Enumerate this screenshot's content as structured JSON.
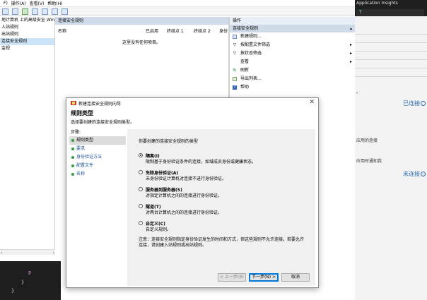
{
  "menubar": {
    "items": [
      "F)",
      "操作(A)",
      "查看(V)",
      "帮助(H)"
    ]
  },
  "tree": {
    "items": [
      "地计算机 上的高级安全 Win",
      "入站规则",
      "出站规则",
      "连接安全规则",
      "监视"
    ],
    "selected_index": 3
  },
  "middle": {
    "title": "连接安全规则",
    "columns": [
      "名称",
      "已启用",
      "终结点 1",
      "终结点 2",
      "身份"
    ],
    "empty_text": "这里没有任何项目。"
  },
  "actions": {
    "header": "操作",
    "section": "连接安全规则",
    "items": [
      {
        "label": "新建规则...",
        "icon": "new-rule-icon"
      },
      {
        "label": "按配置文件筛选",
        "icon": "filter-icon",
        "submenu": true
      },
      {
        "label": "按状态筛选",
        "icon": "filter-icon",
        "submenu": true
      },
      {
        "label": "查看",
        "icon": "",
        "submenu": true
      },
      {
        "label": "刷新",
        "icon": "refresh-icon"
      },
      {
        "label": "导出列表...",
        "icon": "export-icon"
      },
      {
        "label": "帮助",
        "icon": "help-icon"
      }
    ]
  },
  "right_strip": {
    "app_label": "Application Insights",
    "fragments": [
      "。",
      "应用的连接",
      "应用时通知我"
    ],
    "status_connected": "已连接",
    "status_disconnected": "未连接"
  },
  "dialog": {
    "title": "新建连接安全规则向导",
    "heading": "规则类型",
    "subheading": "选择要创建的连接安全规则类型。",
    "steps_label": "步骤:",
    "steps": [
      "规则类型",
      "要求",
      "身份验证方法",
      "配置文件",
      "名称"
    ],
    "current_step": 0,
    "question": "你要创建的连接安全规则的类型",
    "options": [
      {
        "label": "隔离(I)",
        "desc": "限制基于身份验证条件的连接，如域成员身份或健康状态。",
        "selected": true
      },
      {
        "label": "免除身份验证(A)",
        "desc": "未身份验证计算机对连接不进行身份验证。",
        "selected": false
      },
      {
        "label": "服务器到服务器(S)",
        "desc": "对指定计算机之间的连接进行身份验证。",
        "selected": false
      },
      {
        "label": "隧道(T)",
        "desc": "对两台计算机之间的连接进行身份验证。",
        "selected": false
      },
      {
        "label": "自定义(C)",
        "desc": "自定义规则。",
        "selected": false
      }
    ],
    "note": "注意：连接安全规则指定身份验证发生的时间和方式，但这些规则不允许连接。若要允许连接，请创建入站规则或出站规则。",
    "buttons": {
      "back": "< 上一步(B)",
      "next": "下一步(N) >",
      "cancel": "取消"
    }
  },
  "colors": {
    "accent": "#0078d7",
    "selection": "#cce4f7",
    "header": "#cfdbe8",
    "step_dot": "#2e9e3e"
  }
}
